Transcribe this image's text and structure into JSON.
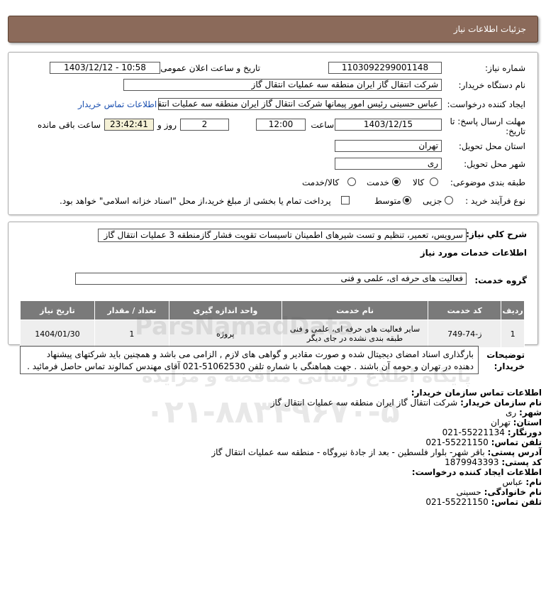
{
  "header": {
    "title": "جزئیات اطلاعات نیاز"
  },
  "form": {
    "need_number_label": "شماره نیاز:",
    "need_number": "1103092299001148",
    "announce_label": "تاریخ و ساعت اعلان عمومی:",
    "announce_value": "1403/12/12 - 10:58",
    "buyer_label": "نام دستگاه خریدار:",
    "buyer_value": "شرکت انتقال گاز ایران منطقه سه عملیات انتقال گاز",
    "creator_label": "ایجاد کننده درخواست:",
    "creator_value": "عباس حسینی رئیس امور پیمانها شرکت انتقال گاز ایران منطقه سه عملیات انتقال گاز",
    "contact_link": "اطلاعات تماس خریدار",
    "deadline_label_1": "مهلت ارسال پاسخ: تا",
    "deadline_label_2": "تاریخ:",
    "deadline_date": "1403/12/15",
    "time_label": "ساعت",
    "deadline_time": "12:00",
    "days_value": "2",
    "days_label": "روز و",
    "remaining_time": "23:42:41",
    "remaining_label": "ساعت باقی مانده",
    "province_label": "استان محل تحویل:",
    "province_value": "تهران",
    "city_label": "شهر محل تحویل:",
    "city_value": "ری",
    "category_label": "طبقه بندی موضوعی:",
    "category_options": [
      "کالا",
      "خدمت",
      "کالا/خدمت"
    ],
    "category_selected": "خدمت",
    "process_label": "نوع فرآیند خرید :",
    "process_options": [
      "جزیی",
      "متوسط"
    ],
    "process_selected": "متوسط",
    "payment_note": "پرداخت تمام یا بخشی از مبلغ خرید،از محل \"اسناد خزانه اسلامی\" خواهد بود."
  },
  "summary": {
    "label": "شرح کلي نياز:",
    "value": "سرویس، تعمیر، تنظیم و تست شیرهای اطمینان تاسیسات تقویت فشار گازمنطقه 3 عملیات انتقال گاز",
    "services_title": "اطلاعات خدمات مورد نیاز",
    "group_label": "گروه خدمت:",
    "group_value": "فعالیت های حرفه ای، علمی و فنی"
  },
  "table": {
    "headers": [
      "ردیف",
      "کد خدمت",
      "نام خدمت",
      "واحد اندازه گیری",
      "تعداد / مقدار",
      "تاریخ نیاز"
    ],
    "rows": [
      [
        "1",
        "ز-74-749",
        "سایر فعالیت های حرفه ای، علمی و فنی طبقه بندی نشده در جای دیگر",
        "پروژه",
        "1",
        "1404/01/30"
      ]
    ]
  },
  "notes": {
    "label_1": "توضیحات",
    "label_2": "خریدار:",
    "text": "بارگذاری اسناد امضای دیجیتال شده و صورت مقادیر و گواهی های لازم , الزامی می باشد و همچنین باید شرکتهای پیشنهاد دهنده در تهران و حومه آن باشند . جهت هماهنگی با شماره تلفن 51062530-021 آقای مهندس کمالوند تماس حاصل فرمائید ."
  },
  "contact": {
    "title": "اطلاعات تماس سازمان خریدار:",
    "org_label": "نام سازمان خریدار:",
    "org_value": "شرکت انتقال گاز ایران منطقه سه عملیات انتقال گاز",
    "city_label": "شهر:",
    "city_value": "ری",
    "province_label": "استان:",
    "province_value": "تهران",
    "fax_label": "دورنگار:",
    "fax_value": "55221134-021",
    "phone_label": "تلفن تماس:",
    "phone_value": "55221150-021",
    "address_label": "آدرس پستی:",
    "address_value": "باقر شهر- بلوار فلسطین - بعد از جادۀ نیروگاه - منطقه سه عملیات انتقال گاز",
    "postal_label": "کد پستی:",
    "postal_value": "1879943393",
    "creator_title": "اطلاعات ایجاد کننده درخواست:",
    "name_label": "نام:",
    "name_value": "عباس",
    "family_label": "نام خانوادگی:",
    "family_value": "حسینی",
    "creator_phone_label": "تلفن تماس:",
    "creator_phone_value": "55221150-021"
  },
  "watermark": {
    "brand": "ParsNamadData",
    "phone": "۰۲۱-۸۸۳۴۹۶۷۰-۵",
    "caption": "پایگاه اطلاع رسانی مناقصه و مزایده"
  },
  "colors": {
    "header_bg": "#8b6a5a",
    "table_header_bg": "#7a7a7a",
    "link": "#1a4fb0"
  }
}
